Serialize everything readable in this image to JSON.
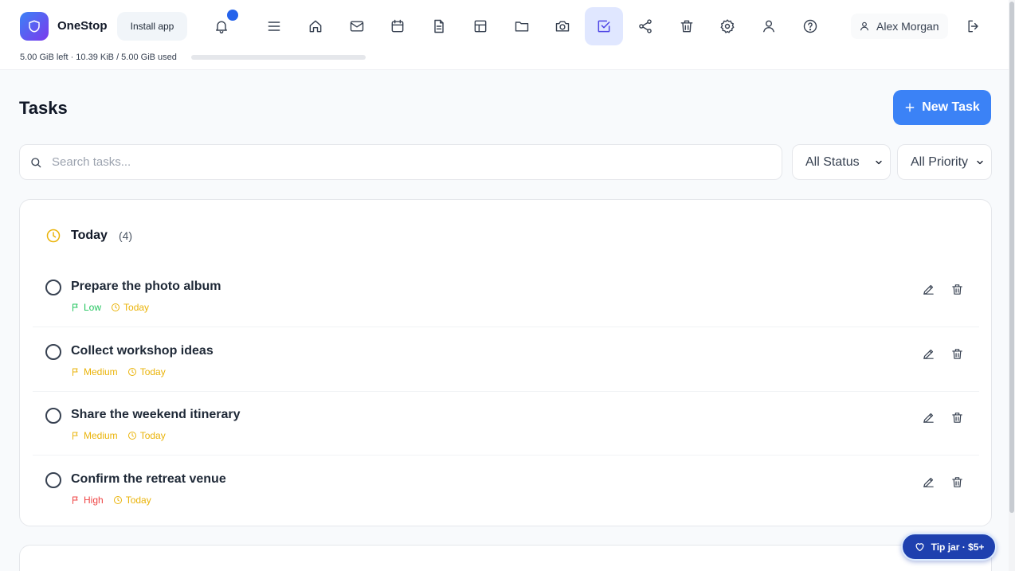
{
  "app": {
    "name": "OneStop",
    "install_label": "Install app"
  },
  "storage": {
    "text": "5.00 GiB left · 10.39 KiB / 5.00 GiB used",
    "used_fraction": 0.0
  },
  "nav": {
    "icons": [
      "bell-icon",
      "menu-icon",
      "home-icon",
      "mail-icon",
      "calendar-icon",
      "document-icon",
      "table-icon",
      "folder-icon",
      "camera-icon",
      "tasks-icon",
      "share-icon",
      "trash-icon",
      "settings-icon",
      "user-icon",
      "help-icon"
    ],
    "active": "tasks-icon"
  },
  "user": {
    "name": "Alex Morgan"
  },
  "page": {
    "title": "Tasks",
    "new_task_label": "New Task"
  },
  "filters": {
    "search_placeholder": "Search tasks...",
    "status": "All Status",
    "priority": "All Priority"
  },
  "group": {
    "title": "Today",
    "count": "(4)",
    "tasks": [
      {
        "title": "Prepare the photo album",
        "priority": "Low",
        "due": "Today"
      },
      {
        "title": "Collect workshop ideas",
        "priority": "Medium",
        "due": "Today"
      },
      {
        "title": "Share the weekend itinerary",
        "priority": "Medium",
        "due": "Today"
      },
      {
        "title": "Confirm the retreat venue",
        "priority": "High",
        "due": "Today"
      }
    ]
  },
  "colors": {
    "accent": "#3b82f6",
    "priority_low": "#22c55e",
    "priority_medium": "#eab308",
    "priority_high": "#ef4444",
    "due_today": "#eab308"
  },
  "tip_jar": {
    "label": "Tip jar · $5+"
  }
}
